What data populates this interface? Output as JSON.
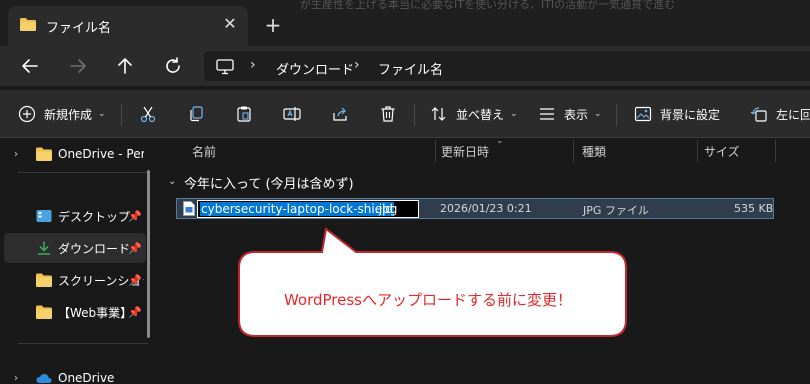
{
  "tab": {
    "title": "ファイル名",
    "close_glyph": "✕",
    "new_tab_glyph": "+"
  },
  "background_text": "が生産性を上げる本当に必要なITを使い分ける、ITIの活動が一気通貫で進む",
  "address": {
    "crumbs": [
      "ダウンロード",
      "ファイル名"
    ]
  },
  "commands": {
    "new": "新規作成",
    "sort": "並べ替え",
    "view": "表示",
    "background": "背景に設定",
    "rotate_left": "左に回転"
  },
  "sidebar": {
    "items": [
      {
        "label": "OneDrive - Perso",
        "icon": "folder-icon"
      },
      {
        "label": "デスクトップ",
        "icon": "desktop-icon"
      },
      {
        "label": "ダウンロード",
        "icon": "download-icon"
      },
      {
        "label": "スクリーンショット",
        "icon": "folder-icon"
      },
      {
        "label": "【Web事業】",
        "icon": "folder-icon"
      },
      {
        "label": "OneDrive",
        "icon": "cloud-icon"
      }
    ],
    "pin_glyph": "📌"
  },
  "columns": {
    "name": "名前",
    "modified": "更新日時",
    "type": "種類",
    "size": "サイズ"
  },
  "group": {
    "title": "今年に入って (今月は含めず)"
  },
  "file": {
    "name_selected": "cybersecurity-laptop-lock-shield",
    "extension": ".jpg",
    "modified": "2026/01/23 0:21",
    "type": "JPG ファイル",
    "size": "535 KB"
  },
  "callout": {
    "text": "WordPressへアップロードする前に変更！",
    "color": "#e8262c"
  },
  "colors": {
    "accent": "#0078d4",
    "folder": "#f2c14e",
    "download": "#3fa45a"
  }
}
